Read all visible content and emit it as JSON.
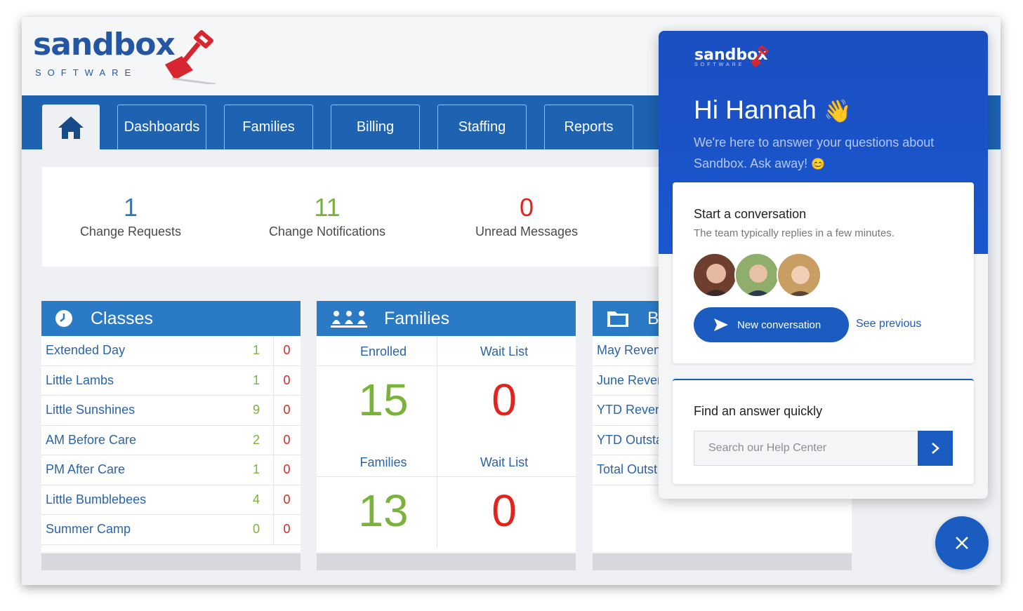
{
  "app": {
    "logo": {
      "wordmark": "sandbox",
      "subtitle": "SOFTWARE"
    },
    "nav": {
      "home_icon": "home-icon",
      "tabs": [
        {
          "label": "Dashboards"
        },
        {
          "label": "Families"
        },
        {
          "label": "Billing"
        },
        {
          "label": "Staffing"
        },
        {
          "label": "Reports"
        }
      ]
    },
    "stats": [
      {
        "value": "1",
        "label": "Change Requests",
        "color": "#2b7ac6"
      },
      {
        "value": "11",
        "label": "Change Notifications",
        "color": "#7ab33a"
      },
      {
        "value": "0",
        "label": "Unread Messages",
        "color": "#e0251f"
      }
    ],
    "classes_card": {
      "title": "Classes",
      "icon": "clock-icon",
      "rows": [
        {
          "name": "Extended Day",
          "enrolled": "1",
          "waitlist": "0"
        },
        {
          "name": "Little Lambs",
          "enrolled": "1",
          "waitlist": "0"
        },
        {
          "name": "Little Sunshines",
          "enrolled": "9",
          "waitlist": "0"
        },
        {
          "name": "AM Before Care",
          "enrolled": "2",
          "waitlist": "0"
        },
        {
          "name": "PM After Care",
          "enrolled": "1",
          "waitlist": "0"
        },
        {
          "name": "Little Bumblebees",
          "enrolled": "4",
          "waitlist": "0"
        },
        {
          "name": "Summer Camp",
          "enrolled": "0",
          "waitlist": "0"
        }
      ]
    },
    "families_card": {
      "title": "Families",
      "icon": "people-icon",
      "enrolled_label": "Enrolled",
      "enrolled_value": "15",
      "waitlist_label": "Wait List",
      "waitlist_value": "0",
      "families_label": "Families",
      "families_value": "13",
      "families_waitlist_label": "Wait List",
      "families_waitlist_value": "0"
    },
    "billing_card": {
      "title": "B",
      "icon": "folder-icon",
      "rows": [
        "May Reven",
        "June Reven",
        "YTD Reven",
        "YTD Outsta",
        "Total Outst"
      ]
    }
  },
  "chat": {
    "logo": {
      "wordmark": "sandbox",
      "subtitle": "SOFTWARE"
    },
    "greeting": "Hi Hannah",
    "greeting_emoji": "👋",
    "intro": "We're here to answer your questions about Sandbox. Ask away!",
    "intro_emoji": "😊",
    "start": {
      "title": "Start a conversation",
      "subtitle": "The team typically replies in a few minutes.",
      "new_button": "New conversation",
      "see_previous": "See previous"
    },
    "find": {
      "title": "Find an answer quickly",
      "placeholder": "Search our Help Center"
    },
    "close_icon": "close-icon",
    "accent": "#1a5cc0"
  }
}
